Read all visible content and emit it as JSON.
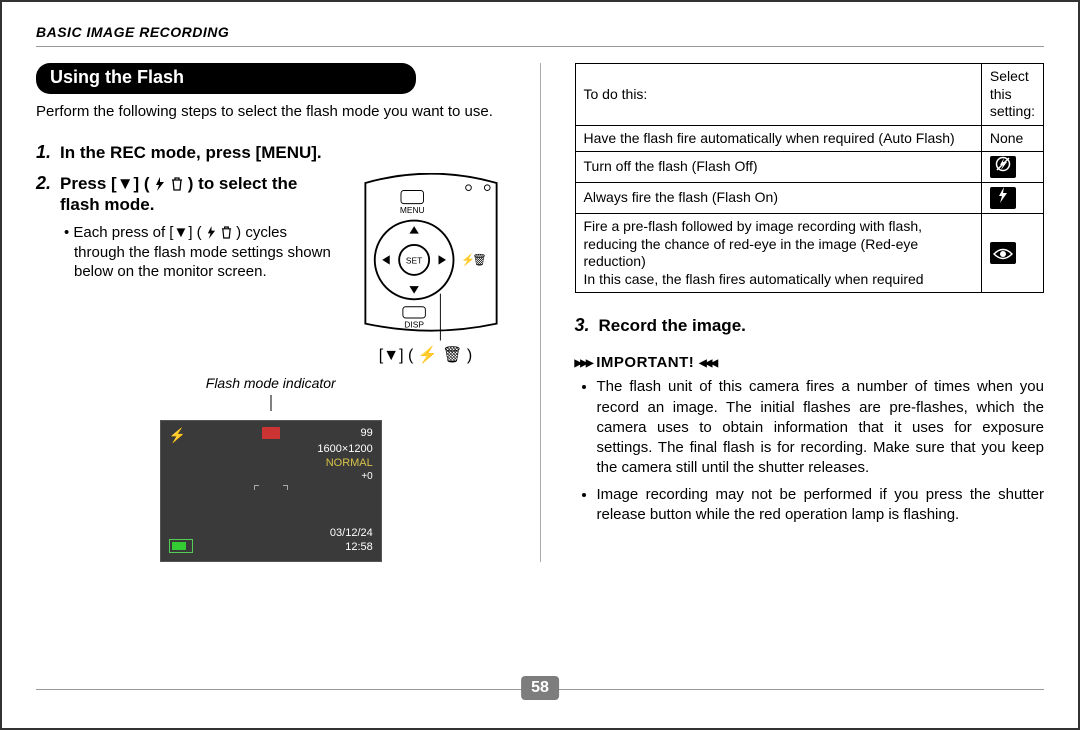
{
  "page_number": "58",
  "running_head": "BASIC IMAGE RECORDING",
  "section_title": "Using the Flash",
  "intro": "Perform the following steps to select the flash mode you want to use.",
  "steps": {
    "s1_num": "1.",
    "s1": "In the REC mode, press [MENU].",
    "s2_num": "2.",
    "s2_a": "Press [▼] (",
    "s2_b": ") to select the flash mode.",
    "s2_sub_a": "• Each press of [▼] (",
    "s2_sub_b": ") cycles through the flash mode settings shown below on the monitor screen.",
    "s3_num": "3.",
    "s3": "Record the image."
  },
  "diagram": {
    "menu": "MENU",
    "set": "SET",
    "disp": "DISP",
    "key_caption": "[▼] ( ⚡ 🗑 )"
  },
  "screen": {
    "caption": "Flash mode indicator",
    "count": "99",
    "res": "1600×1200",
    "quality": "NORMAL",
    "ev": "+0",
    "date": "03/12/24",
    "time": "12:58"
  },
  "table": {
    "h1": "To do this:",
    "h2": "Select this setting:",
    "rows": [
      {
        "desc": "Have the flash fire automatically when required (Auto Flash)",
        "setting": "None",
        "icon": "none"
      },
      {
        "desc": "Turn off the flash (Flash Off)",
        "setting": "",
        "icon": "off"
      },
      {
        "desc": "Always fire the flash (Flash On)",
        "setting": "",
        "icon": "on"
      },
      {
        "desc": "Fire a pre-flash followed by image recording with flash, reducing the chance of red-eye in the image (Red-eye reduction)\nIn this case, the flash fires automatically when required",
        "setting": "",
        "icon": "eye"
      }
    ]
  },
  "important": {
    "label": "IMPORTANT!",
    "n1": "The flash unit of this camera fires a number of times when you record an image. The initial flashes are pre-flashes, which the camera uses to obtain information that it uses for exposure settings. The final flash is for recording. Make sure that you keep the camera still until the shutter releases.",
    "n2": "Image recording may not be performed if you press the shutter release button while the red operation lamp is flashing."
  }
}
